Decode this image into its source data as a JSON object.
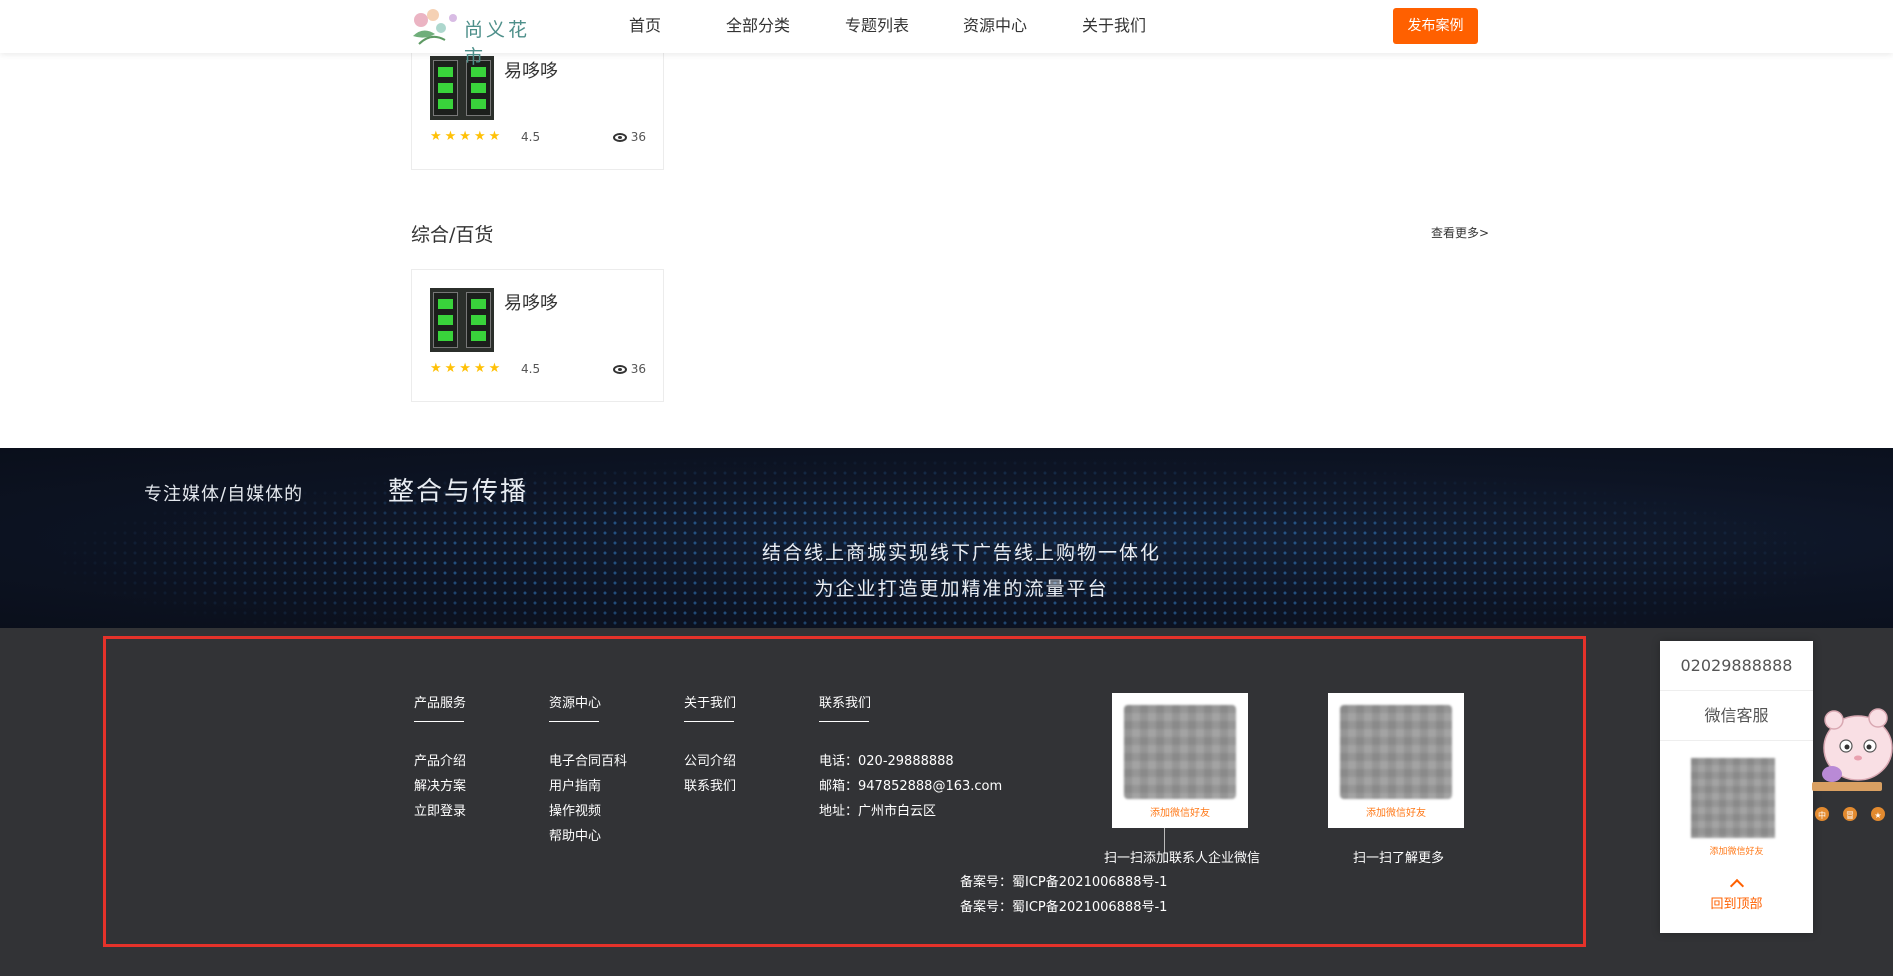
{
  "header": {
    "logo_text": "尚义花市",
    "nav": [
      "首页",
      "全部分类",
      "专题列表",
      "资源中心",
      "关于我们"
    ],
    "publish_label": "发布案例"
  },
  "cards": [
    {
      "title": "易哆哆",
      "stars": "★★★★★",
      "rating": "4.5",
      "views": "36"
    },
    {
      "title": "易哆哆",
      "stars": "★★★★★",
      "rating": "4.5",
      "views": "36"
    }
  ],
  "section": {
    "title": "综合/百货",
    "more": "查看更多>"
  },
  "banner": {
    "sub": "专注媒体/自媒体的",
    "title": "整合与传播",
    "line1": "结合线上商城实现线下广告线上购物一体化",
    "line2": "为企业打造更加精准的流量平台"
  },
  "footer": {
    "columns": [
      {
        "head": "产品服务",
        "items": [
          "产品介绍",
          "解决方案",
          "立即登录"
        ]
      },
      {
        "head": "资源中心",
        "items": [
          "电子合同百科",
          "用户指南",
          "操作视频",
          "帮助中心"
        ]
      },
      {
        "head": "关于我们",
        "items": [
          "公司介绍",
          "联系我们"
        ]
      },
      {
        "head": "联系我们",
        "items": [
          "电话：020-29888888",
          "邮箱：947852888@163.com",
          "地址：广州市白云区"
        ]
      }
    ],
    "qr": [
      {
        "caption": "添加微信好友",
        "label": "扫一扫添加联系人企业微信"
      },
      {
        "caption": "添加微信好友",
        "label": "扫一扫了解更多"
      }
    ],
    "icp": [
      "备案号：蜀ICP备2021006888号-1",
      "备案号：蜀ICP备2021006888号-1"
    ]
  },
  "side": {
    "phone": "02029888888",
    "wechat": "微信客服",
    "qr_caption": "添加微信好友",
    "back_top": "回到顶部"
  },
  "colors": {
    "accent": "#ff6000",
    "footer_bg": "#323336",
    "frame_red": "#e5322a",
    "star": "#ffc107"
  }
}
